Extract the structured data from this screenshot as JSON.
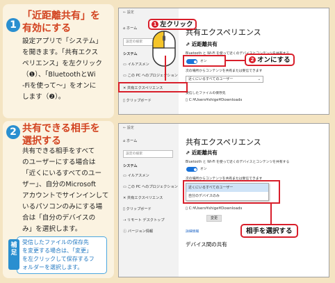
{
  "step1": {
    "number": "1",
    "title_line1": "「近距離共有」を",
    "title_line2": "有効にする",
    "body_lines": [
      "設定アプリで「システム」",
      "を開きます。「共有エクス",
      "ペリエンス」を左クリック",
      "（❶）、「BluetoothとWi",
      "-Fiを使って〜」をオンに",
      "します（❷）。"
    ]
  },
  "step2": {
    "number": "2",
    "title_line1": "共有できる相手を",
    "title_line2": "選択する",
    "body_lines": [
      "共有できる相手をすべて",
      "のユーザーにする場合は",
      "「近くにいるすべてのユー",
      "ザー」、自分のMicrosoft",
      "アカウントでサインインして",
      "いるパソコンのみにする場",
      "合は「自分のデバイスの",
      "み」を選択します。"
    ]
  },
  "note": {
    "tag": "補足",
    "lines": [
      "受信したファイルの保存先",
      "を変更する場合は、「変更」",
      "を左クリックして保存するフ",
      "ォルダーを選択します。"
    ]
  },
  "window1": {
    "titlebar": "← 設定",
    "home": "ホーム",
    "search_placeholder": "設定の検索",
    "section": "システム",
    "nav_items": [
      "イルアスメン",
      "この PC へのプロジェクション",
      "共有エクスペリエンス",
      "クリップボード"
    ],
    "heading": "共有エクスペリエンス",
    "subheading": "近距離共有",
    "desc": "Bluetooth と Wi-Fi を使って近くのデバイスとコンテンツを共有する",
    "toggle_label": "オン",
    "share_with": "次の場所からコンテンツを共有または受信できます",
    "dropdown_value": "近くにいるすべてのユーザー",
    "save_location_label": "受信したファイルの保存先",
    "save_path": "C:¥Users¥shige¥Downloads"
  },
  "window2": {
    "titlebar": "← 設定",
    "home": "ホーム",
    "search_placeholder": "設定の検索",
    "section": "システム",
    "nav_items": [
      "イルアスメン",
      "この PC へのプロジェクション",
      "共有エクスペリエンス",
      "クリップボード",
      "リモート デスクトップ",
      "バージョン情報"
    ],
    "heading": "共有エクスペリエンス",
    "subheading": "近距離共有",
    "desc": "Bluetooth と Wi-Fi を使って近くのデバイスとコンテンツを共有する",
    "toggle_label": "オン",
    "share_with": "次の場所からコンテンツを共有または受信できます",
    "options": [
      "近くにいるすべてのユーザー",
      "自分のデバイスのみ"
    ],
    "save_path": "C:¥Users¥shige¥Downloads",
    "change_button": "変更",
    "details_link": "詳細情報",
    "cross_device": "デバイス間の共有"
  },
  "callouts": {
    "left_click": "左クリック",
    "left_click_num": "❶",
    "turn_on": "オンにする",
    "turn_on_num": "❷",
    "select_target": "相手を選択する"
  },
  "colors": {
    "background": "#f4e4c2",
    "title_red": "#d2421f",
    "step_blue": "#2a8fd0",
    "highlight_red": "#d81e2a",
    "toggle_blue": "#1a73d9"
  }
}
